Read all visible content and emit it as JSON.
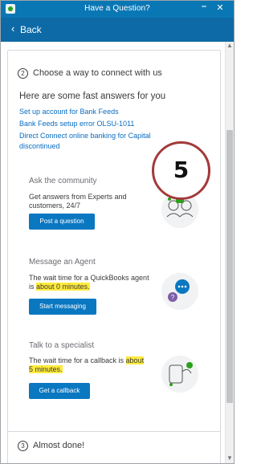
{
  "window": {
    "title": "Have a Question?",
    "minimize_glyph": "–",
    "close_glyph": "✕"
  },
  "nav": {
    "back_label": "Back"
  },
  "step2": {
    "number": "2",
    "title": "Choose a way to connect with us"
  },
  "fast_answers": {
    "title": "Here are some fast answers for you",
    "links": [
      "Set up account for Bank Feeds",
      "Bank Feeds setup error OLSU-1011",
      "Direct Connect online banking for Capital",
      "discontinued"
    ]
  },
  "community": {
    "heading": "Ask the community",
    "description": "Get answers from Experts and customers, 24/7",
    "button_label": "Post a question",
    "icon": "community-illustration"
  },
  "agent": {
    "heading": "Message an Agent",
    "description_prefix": "The wait time for a QuickBooks agent is ",
    "description_highlight": "about 0 minutes.",
    "button_label": "Start messaging",
    "icon": "chat-illustration"
  },
  "specialist": {
    "heading": "Talk to a specialist",
    "description_prefix": "The wait time for a callback is ",
    "description_highlight": "about 5 minutes.",
    "button_label": "Get a callback",
    "icon": "phone-illustration"
  },
  "step3": {
    "number": "3",
    "title": "Almost done!"
  },
  "annotation": {
    "label": "5"
  },
  "colors": {
    "titlebar": "#0a77b5",
    "backbar": "#0d6aa6",
    "link": "#0a6cc0",
    "button": "#0a77c1",
    "highlight": "#ffeb3b",
    "annotation_ring": "#a33a3a"
  }
}
